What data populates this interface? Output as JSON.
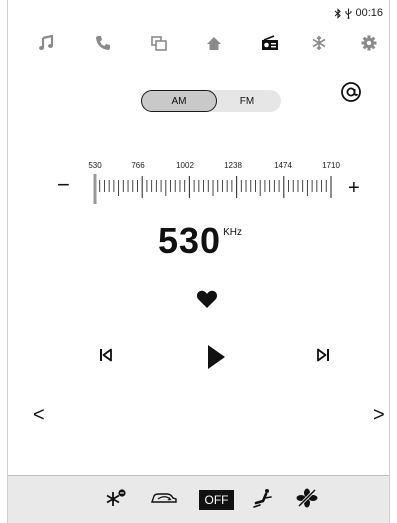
{
  "status_bar": {
    "icons": [
      "bluetooth-icon",
      "usb-icon"
    ],
    "time": "00:16"
  },
  "nav": {
    "items": [
      {
        "name": "music",
        "icon": "music-note-icon"
      },
      {
        "name": "phone",
        "icon": "phone-icon"
      },
      {
        "name": "mirror",
        "icon": "screen-mirror-icon"
      },
      {
        "name": "home",
        "icon": "home-icon"
      },
      {
        "name": "radio",
        "icon": "radio-icon",
        "active": true
      },
      {
        "name": "climate",
        "icon": "snowflake-icon"
      },
      {
        "name": "settings",
        "icon": "gear-icon"
      }
    ]
  },
  "band": {
    "am_label": "AM",
    "fm_label": "FM",
    "selected": "AM"
  },
  "scan": {
    "icon": "scan-at-icon"
  },
  "tuner": {
    "minus_label": "−",
    "plus_label": "+",
    "scale_labels": [
      "530",
      "766",
      "1002",
      "1238",
      "1474",
      "1710"
    ],
    "range": [
      530,
      1710
    ],
    "current": 530
  },
  "frequency": {
    "value": "530",
    "unit": "KHz"
  },
  "favorite": {
    "icon": "heart-icon"
  },
  "playback": {
    "prev_icon": "skip-previous-icon",
    "play_icon": "play-icon",
    "next_icon": "skip-next-icon"
  },
  "paging": {
    "left_label": "<",
    "right_label": ">"
  },
  "climate_bar": {
    "items": [
      "defrost-icon",
      "air-recirculation-icon",
      "off-button",
      "seat-airflow-icon",
      "fan-off-icon"
    ],
    "off_label": "OFF"
  }
}
